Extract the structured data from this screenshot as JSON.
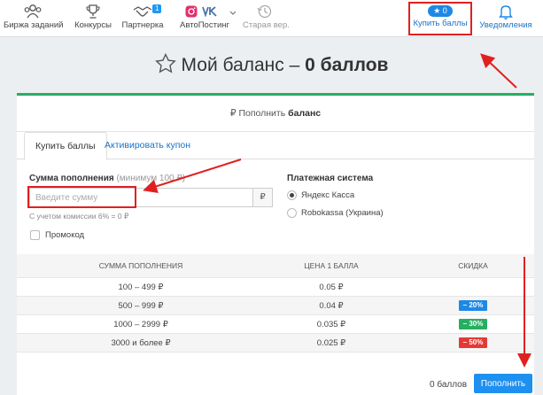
{
  "nav": {
    "items": [
      {
        "label": "Биржа заданий",
        "icon": "users-icon"
      },
      {
        "label": "Конкурсы",
        "icon": "trophy-icon"
      },
      {
        "label": "Партнерка",
        "icon": "handshake-icon",
        "badge": "1"
      },
      {
        "label": "АвтоПостинг",
        "icon": "social-icons"
      },
      {
        "label": "Старая вер.",
        "icon": "history-icon"
      }
    ],
    "points_badge": "0",
    "buy_points": "Купить баллы",
    "notifications": "Уведомления"
  },
  "page": {
    "title_prefix": "Мой баланс – ",
    "title_value": "0 баллов"
  },
  "card": {
    "header_prefix": "₽ Пополнить ",
    "header_bold": "баланс",
    "tabs": [
      "Купить баллы",
      "Активировать купон"
    ],
    "amount_label": "Сумма пополнения",
    "amount_hint": "(минимум 100 ₽)",
    "amount_placeholder": "Введите сумму",
    "currency": "₽",
    "commission_note": "С учетом комиссии 6% = 0 ₽",
    "promo_label": "Промокод",
    "payment_label": "Платежная система",
    "payment_options": [
      {
        "label": "Яндекс Касса",
        "selected": true
      },
      {
        "label": "Robokassa (Украина)",
        "selected": false
      }
    ],
    "table": {
      "headers": [
        "СУММА ПОПОЛНЕНИЯ",
        "ЦЕНА 1 БАЛЛА",
        "СКИДКА"
      ],
      "rows": [
        {
          "range": "100 – 499 ₽",
          "price": "0.05 ₽",
          "discount": ""
        },
        {
          "range": "500 – 999 ₽",
          "price": "0.04 ₽",
          "discount": "– 20%",
          "color": "#1e88e5"
        },
        {
          "range": "1000 – 2999 ₽",
          "price": "0.035 ₽",
          "discount": "– 30%",
          "color": "#27ae60"
        },
        {
          "range": "3000 и более ₽",
          "price": "0.025 ₽",
          "discount": "– 50%",
          "color": "#e53935"
        }
      ]
    },
    "total": "0 баллов",
    "pay_button": "Пополнить"
  }
}
